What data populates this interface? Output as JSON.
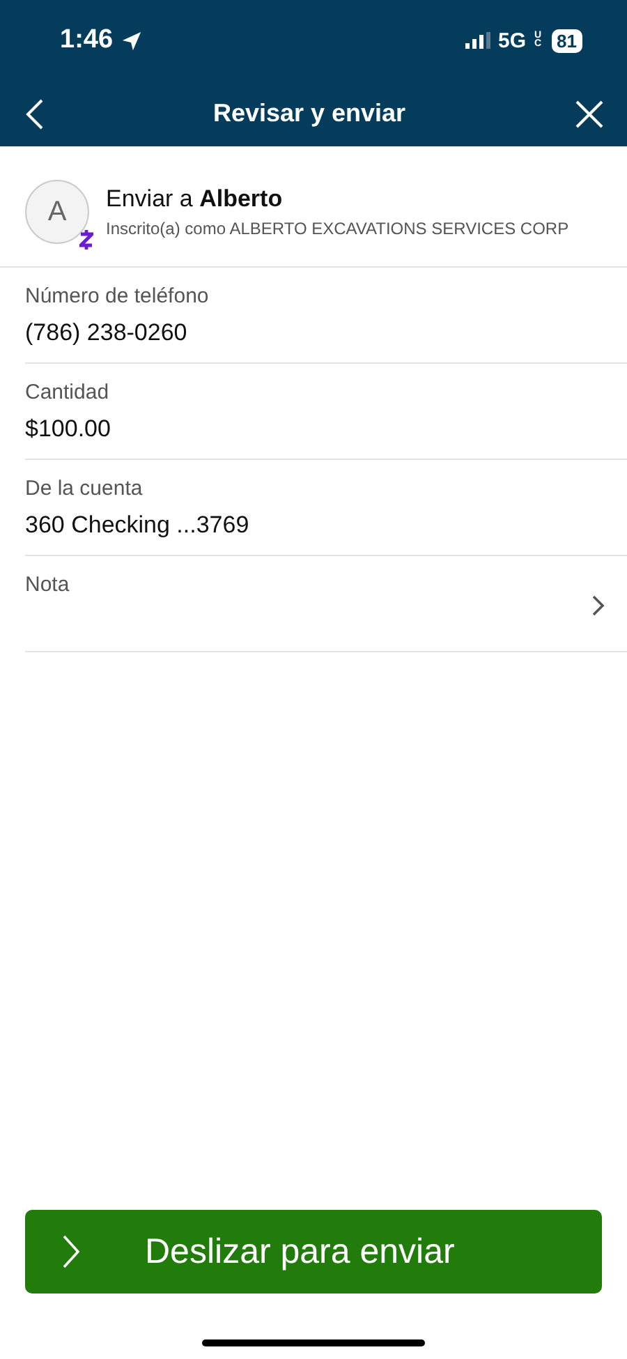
{
  "status_bar": {
    "time": "1:46",
    "network": "5G",
    "network_suffix": "UC",
    "battery": "81"
  },
  "nav": {
    "title": "Revisar y enviar"
  },
  "recipient": {
    "initial": "A",
    "heading": "Enviar a **Alberto**",
    "subtitle": "Inscrito(a) como ALBERTO EXCAVATIONS SERVICES CORP"
  },
  "fields": [
    {
      "kind": "value",
      "label": "Número de teléfono",
      "value": "(786) 238-0260"
    },
    {
      "kind": "value",
      "label": "Cantidad",
      "value": "$100.00"
    },
    {
      "kind": "value",
      "label": "De la cuenta",
      "value": "360 Checking ...3769"
    },
    {
      "kind": "link",
      "label": "Nota"
    }
  ],
  "slider": {
    "label": "Deslizar para enviar"
  }
}
